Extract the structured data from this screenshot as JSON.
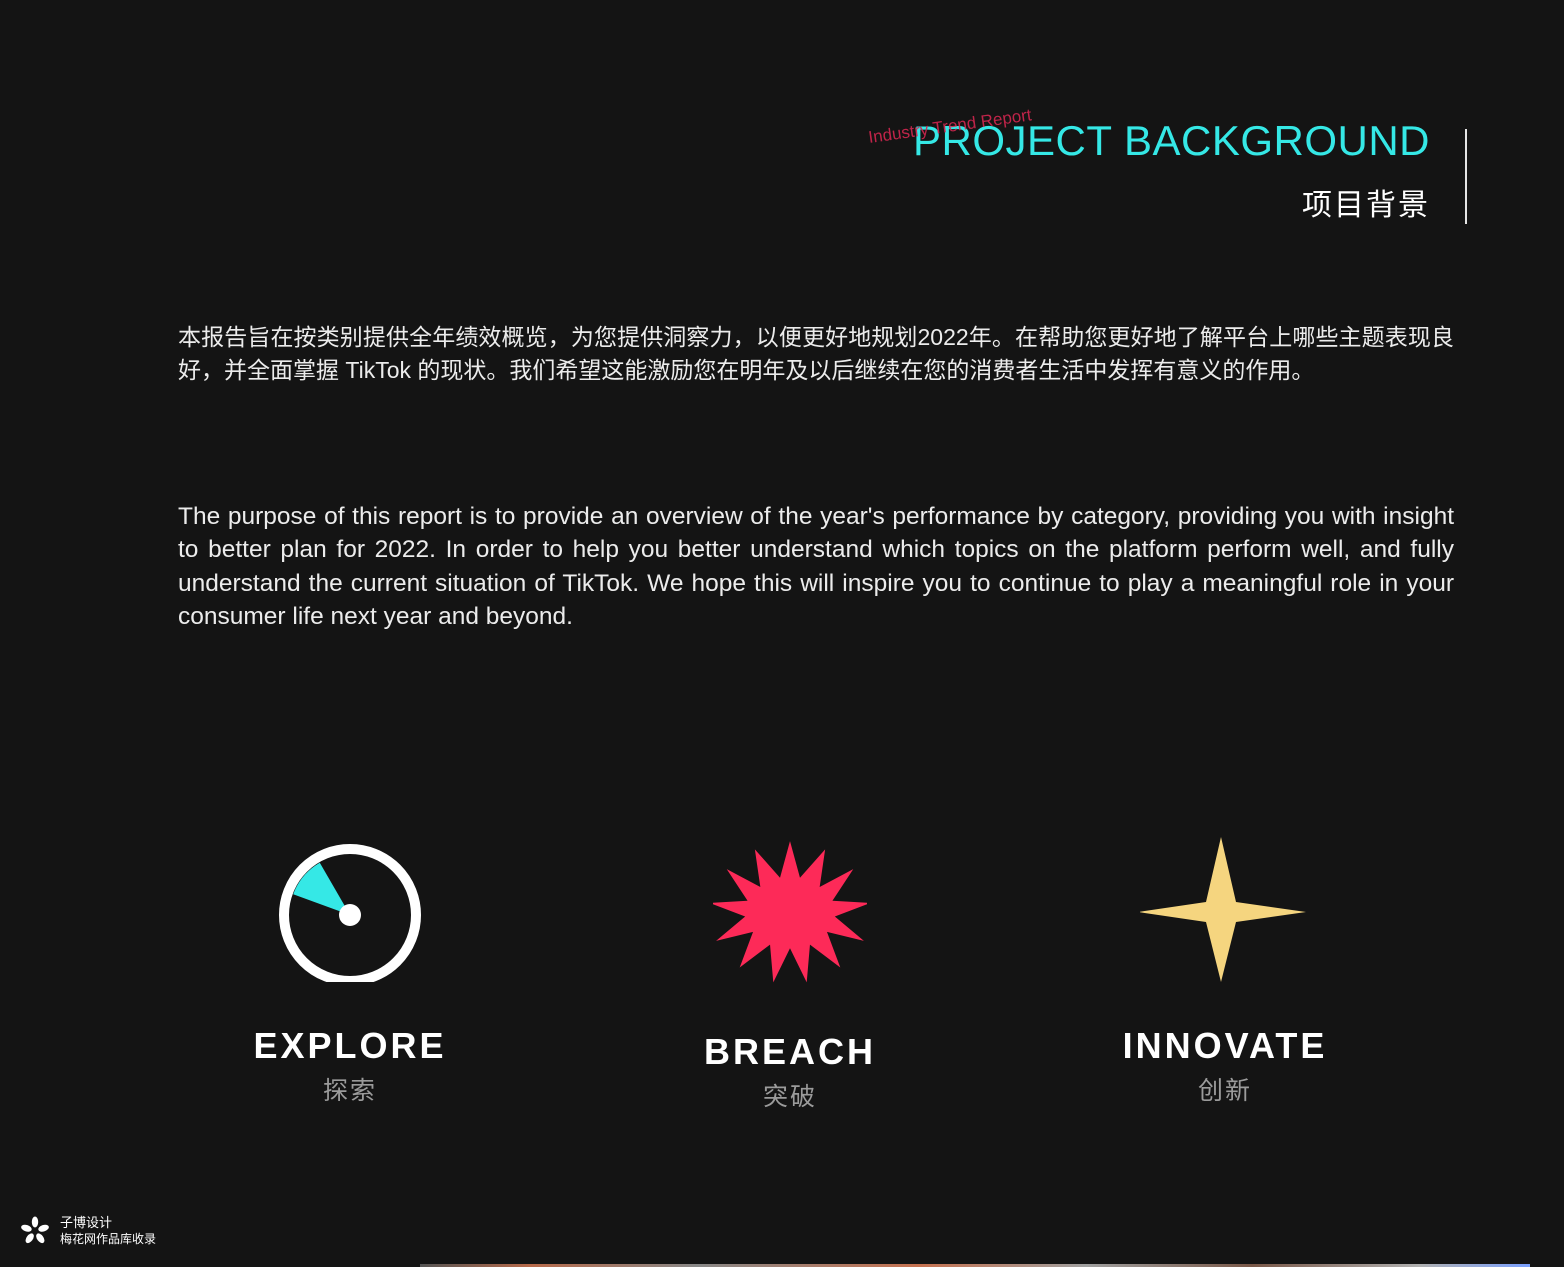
{
  "header": {
    "title_en": "PROJECT BACKGROUND",
    "title_cn": "项目背景",
    "watermark": "Industry Trend Report"
  },
  "body": {
    "paragraph_cn": "本报告旨在按类别提供全年绩效概览，为您提供洞察力，以便更好地规划2022年。在帮助您更好地了解平台上哪些主题表现良好，并全面掌握 TikTok 的现状。我们希望这能激励您在明年及以后继续在您的消费者生活中发挥有意义的作用。",
    "paragraph_en": "The purpose of this report is to provide an overview of the year's performance by category, providing you with insight to better plan for 2022. In order to help you better understand which topics on the platform perform well, and fully understand the current situation of TikTok. We hope this will inspire you to continue to play a meaningful role in your consumer life next year and beyond."
  },
  "features": [
    {
      "label": "EXPLORE",
      "sub": "探索",
      "icon": "compass-icon",
      "color": "#35e8e6"
    },
    {
      "label": "BREACH",
      "sub": "突破",
      "icon": "starburst-icon",
      "color": "#fd2a58"
    },
    {
      "label": "INNOVATE",
      "sub": "创新",
      "icon": "sparkle-star-icon",
      "color": "#f5d57f"
    }
  ],
  "brand": {
    "name": "子博设计",
    "subtitle": "梅花网作品库收录",
    "icon": "flower-logo-icon"
  }
}
